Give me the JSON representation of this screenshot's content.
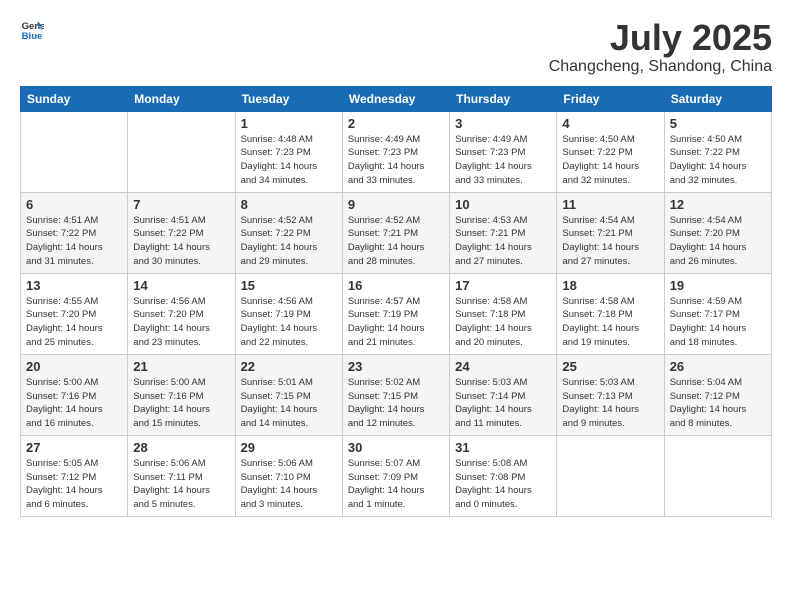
{
  "header": {
    "logo_general": "General",
    "logo_blue": "Blue",
    "month": "July 2025",
    "location": "Changcheng, Shandong, China"
  },
  "weekdays": [
    "Sunday",
    "Monday",
    "Tuesday",
    "Wednesday",
    "Thursday",
    "Friday",
    "Saturday"
  ],
  "weeks": [
    [
      {
        "day": "",
        "info": ""
      },
      {
        "day": "",
        "info": ""
      },
      {
        "day": "1",
        "info": "Sunrise: 4:48 AM\nSunset: 7:23 PM\nDaylight: 14 hours\nand 34 minutes."
      },
      {
        "day": "2",
        "info": "Sunrise: 4:49 AM\nSunset: 7:23 PM\nDaylight: 14 hours\nand 33 minutes."
      },
      {
        "day": "3",
        "info": "Sunrise: 4:49 AM\nSunset: 7:23 PM\nDaylight: 14 hours\nand 33 minutes."
      },
      {
        "day": "4",
        "info": "Sunrise: 4:50 AM\nSunset: 7:22 PM\nDaylight: 14 hours\nand 32 minutes."
      },
      {
        "day": "5",
        "info": "Sunrise: 4:50 AM\nSunset: 7:22 PM\nDaylight: 14 hours\nand 32 minutes."
      }
    ],
    [
      {
        "day": "6",
        "info": "Sunrise: 4:51 AM\nSunset: 7:22 PM\nDaylight: 14 hours\nand 31 minutes."
      },
      {
        "day": "7",
        "info": "Sunrise: 4:51 AM\nSunset: 7:22 PM\nDaylight: 14 hours\nand 30 minutes."
      },
      {
        "day": "8",
        "info": "Sunrise: 4:52 AM\nSunset: 7:22 PM\nDaylight: 14 hours\nand 29 minutes."
      },
      {
        "day": "9",
        "info": "Sunrise: 4:52 AM\nSunset: 7:21 PM\nDaylight: 14 hours\nand 28 minutes."
      },
      {
        "day": "10",
        "info": "Sunrise: 4:53 AM\nSunset: 7:21 PM\nDaylight: 14 hours\nand 27 minutes."
      },
      {
        "day": "11",
        "info": "Sunrise: 4:54 AM\nSunset: 7:21 PM\nDaylight: 14 hours\nand 27 minutes."
      },
      {
        "day": "12",
        "info": "Sunrise: 4:54 AM\nSunset: 7:20 PM\nDaylight: 14 hours\nand 26 minutes."
      }
    ],
    [
      {
        "day": "13",
        "info": "Sunrise: 4:55 AM\nSunset: 7:20 PM\nDaylight: 14 hours\nand 25 minutes."
      },
      {
        "day": "14",
        "info": "Sunrise: 4:56 AM\nSunset: 7:20 PM\nDaylight: 14 hours\nand 23 minutes."
      },
      {
        "day": "15",
        "info": "Sunrise: 4:56 AM\nSunset: 7:19 PM\nDaylight: 14 hours\nand 22 minutes."
      },
      {
        "day": "16",
        "info": "Sunrise: 4:57 AM\nSunset: 7:19 PM\nDaylight: 14 hours\nand 21 minutes."
      },
      {
        "day": "17",
        "info": "Sunrise: 4:58 AM\nSunset: 7:18 PM\nDaylight: 14 hours\nand 20 minutes."
      },
      {
        "day": "18",
        "info": "Sunrise: 4:58 AM\nSunset: 7:18 PM\nDaylight: 14 hours\nand 19 minutes."
      },
      {
        "day": "19",
        "info": "Sunrise: 4:59 AM\nSunset: 7:17 PM\nDaylight: 14 hours\nand 18 minutes."
      }
    ],
    [
      {
        "day": "20",
        "info": "Sunrise: 5:00 AM\nSunset: 7:16 PM\nDaylight: 14 hours\nand 16 minutes."
      },
      {
        "day": "21",
        "info": "Sunrise: 5:00 AM\nSunset: 7:16 PM\nDaylight: 14 hours\nand 15 minutes."
      },
      {
        "day": "22",
        "info": "Sunrise: 5:01 AM\nSunset: 7:15 PM\nDaylight: 14 hours\nand 14 minutes."
      },
      {
        "day": "23",
        "info": "Sunrise: 5:02 AM\nSunset: 7:15 PM\nDaylight: 14 hours\nand 12 minutes."
      },
      {
        "day": "24",
        "info": "Sunrise: 5:03 AM\nSunset: 7:14 PM\nDaylight: 14 hours\nand 11 minutes."
      },
      {
        "day": "25",
        "info": "Sunrise: 5:03 AM\nSunset: 7:13 PM\nDaylight: 14 hours\nand 9 minutes."
      },
      {
        "day": "26",
        "info": "Sunrise: 5:04 AM\nSunset: 7:12 PM\nDaylight: 14 hours\nand 8 minutes."
      }
    ],
    [
      {
        "day": "27",
        "info": "Sunrise: 5:05 AM\nSunset: 7:12 PM\nDaylight: 14 hours\nand 6 minutes."
      },
      {
        "day": "28",
        "info": "Sunrise: 5:06 AM\nSunset: 7:11 PM\nDaylight: 14 hours\nand 5 minutes."
      },
      {
        "day": "29",
        "info": "Sunrise: 5:06 AM\nSunset: 7:10 PM\nDaylight: 14 hours\nand 3 minutes."
      },
      {
        "day": "30",
        "info": "Sunrise: 5:07 AM\nSunset: 7:09 PM\nDaylight: 14 hours\nand 1 minute."
      },
      {
        "day": "31",
        "info": "Sunrise: 5:08 AM\nSunset: 7:08 PM\nDaylight: 14 hours\nand 0 minutes."
      },
      {
        "day": "",
        "info": ""
      },
      {
        "day": "",
        "info": ""
      }
    ]
  ]
}
